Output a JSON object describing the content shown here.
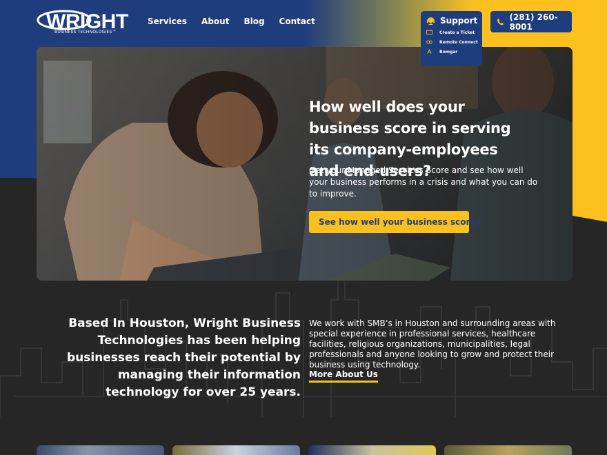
{
  "logo": {
    "wordmark": "WRIGHT",
    "tagline": "BUSINESS TECHNOLOGIES",
    "trademark": "™"
  },
  "nav": {
    "items": [
      "Services",
      "About",
      "Blog",
      "Contact"
    ]
  },
  "support": {
    "title": "Support",
    "items": [
      {
        "label": "Create a Ticket",
        "icon": "ticket-icon"
      },
      {
        "label": "Remote Connect",
        "icon": "remote-connect-icon"
      },
      {
        "label": "Bomgar",
        "icon": "bomgar-icon"
      }
    ]
  },
  "phone": {
    "number": "(281) 260-8001",
    "icon": "phone-icon"
  },
  "hero": {
    "title": "How well does your business score in serving its company-employees and end-users?",
    "body": "Get your Managed Services Score and see how well your business performs in a crisis and what you can do to improve.",
    "cta": "See how well your business scores",
    "cta_icon": "trophy-icon"
  },
  "about": {
    "heading": "Based In Houston, Wright Business Technologies has been helping businesses reach their potential by managing their information technology for over 25 years.",
    "body": "We work with SMB’s in Houston and surrounding areas with special experience in professional services, healthcare facilities, religious organizations, municipalities, legal professionals and anyone looking to grow and protect their business using technology.",
    "link": "More About Us"
  },
  "colors": {
    "navy": "#1f3c7d",
    "yellow": "#fcc11f",
    "dark": "#262626"
  }
}
